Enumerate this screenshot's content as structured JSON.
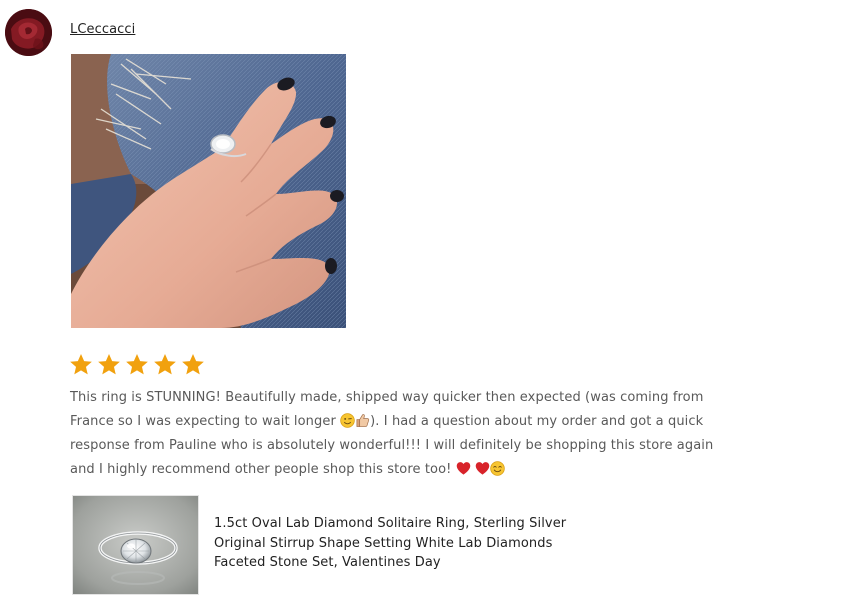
{
  "review": {
    "reviewer_name": "LCeccacci",
    "rating": 5,
    "rating_max": 5,
    "star_color": "#F1A10E",
    "text_lines": [
      "This ring is STUNNING! Beautifully made, shipped way quicker then expected (was coming from",
      "France so I was expecting to wait longer",
      "). I had a question about my order and got a quick",
      "response from Pauline who is absolutely wonderful!!! I will definitely be shopping this store again",
      "and I highly recommend other people shop this store too!"
    ],
    "inline_emoji": [
      "winking-face-icon",
      "thumbs-up-icon"
    ],
    "trailing_emoji": [
      "red-heart-icon",
      "red-heart-icon",
      "smiling-face-icon"
    ]
  },
  "listing": {
    "title_lines": [
      "1.5ct Oval Lab Diamond Solitaire Ring, Sterling Silver",
      "Original Stirrup Shape Setting White Lab Diamonds",
      "Faceted Stone Set, Valentines Day"
    ]
  }
}
